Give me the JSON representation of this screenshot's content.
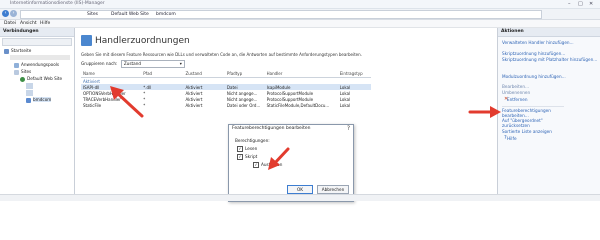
{
  "titlebar": {
    "title": "Internetinformationsdienste (IIS)-Manager"
  },
  "address": {
    "crumbs": [
      "Sites",
      "Default Web Site",
      "bmdcom"
    ]
  },
  "menu": {
    "items": [
      "Datei",
      "Ansicht",
      "Hilfe"
    ]
  },
  "connections": {
    "header": "Verbindungen",
    "tree": [
      {
        "label": "Startseite"
      },
      {
        "label": "Anwendungspools"
      },
      {
        "label": "Sites"
      },
      {
        "label": "Default Web Site"
      },
      {
        "label": "bmdcom"
      }
    ]
  },
  "main": {
    "title": "Handlerzuordnungen",
    "description": "Geben Sie mit diesem Feature Ressourcen wie DLLs und verwalteten Code an, die Antworten auf bestimmte Anforderungstypen bearbeiten.",
    "groupby_label": "Gruppieren nach:",
    "groupby_value": "Zustand",
    "columns": [
      "Name",
      "Pfad",
      "Zustand",
      "Pfadtyp",
      "Handler",
      "Eintragstyp"
    ],
    "group_label": "Aktiviert",
    "rows": [
      [
        "ISAPI-dll",
        "*.dll",
        "Aktiviert",
        "Datei",
        "IsapiModule",
        "Lokal"
      ],
      [
        "OPTIONSVerbHandler",
        "*",
        "Aktiviert",
        "Nicht angege...",
        "ProtocolSupportModule",
        "Lokal"
      ],
      [
        "TRACEVerbHandler",
        "*",
        "Aktiviert",
        "Nicht angege...",
        "ProtocolSupportModule",
        "Lokal"
      ],
      [
        "StaticFile",
        "*",
        "Aktiviert",
        "Datei oder Ord...",
        "StaticFileModule,DefaultDocu...",
        "Lokal"
      ]
    ]
  },
  "dialog": {
    "title": "Featureberechtigungen bearbeiten",
    "close": "?",
    "label": "Berechtigungen:",
    "options": [
      {
        "label": "Lesen",
        "checked": "✓"
      },
      {
        "label": "Skript",
        "checked": "✓"
      },
      {
        "label": "Ausführen",
        "checked": "✓"
      }
    ],
    "ok": "OK",
    "cancel": "Abbrechen"
  },
  "actions": {
    "header": "Aktionen",
    "items": [
      "Verwalteten Handler hinzufügen...",
      "Skriptzuordnung hinzufügen...",
      "Skriptzuordnung mit Platzhalter hinzufügen...",
      "Modulzuordnung hinzufügen...",
      "Bearbeiten...",
      "Umbenennen",
      "Entfernen",
      "Featureberechtigungen bearbeiten...",
      "Auf \"übergeordnet\" zurücksetzen",
      "Sortierte Liste anzeigen",
      "Hilfe"
    ]
  },
  "colors": {
    "accent": "#3d7dd0",
    "arrow": "#e23b2e",
    "selected_row": "#d6e4f5"
  }
}
